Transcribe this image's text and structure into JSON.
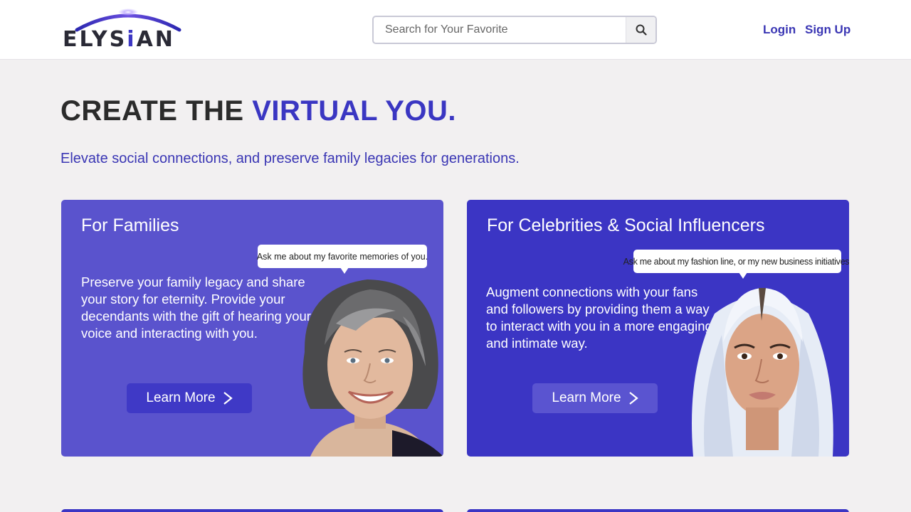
{
  "header": {
    "logo": {
      "text_before": "ELYS",
      "accent_letter": "i",
      "text_after": "AN"
    },
    "search": {
      "placeholder": "Search for Your Favorite",
      "value": "",
      "icon": "search-icon"
    },
    "nav": {
      "login": "Login",
      "signup": "Sign Up"
    }
  },
  "hero": {
    "title_plain": "CREATE THE",
    "title_accent": "VIRTUAL YOU.",
    "subtitle": "Elevate social connections, and preserve family legacies for generations."
  },
  "cards": [
    {
      "title": "For Families",
      "text": "Preserve your family legacy and share your story for eternity. Provide your decendants with the gift of hearing your voice and interacting with you.",
      "bubble": "Ask me about my favorite memories of you.",
      "button": "Learn More",
      "button_icon": "chevron-right-icon",
      "portrait": "older-woman-portrait"
    },
    {
      "title": "For Celebrities & Social Influencers",
      "text": "Augment connections with your fans and followers by providing them a way to interact with you in a more engaging and intimate way.",
      "bubble": "Ask me about my fashion line, or my new business initiatives.",
      "button": "Learn More",
      "button_icon": "chevron-right-icon",
      "portrait": "influencer-portrait"
    }
  ],
  "colors": {
    "accent": "#3a36c2",
    "card_families": "#5a53cd",
    "card_celebs": "#3b35c4",
    "background": "#f2f0f1"
  }
}
